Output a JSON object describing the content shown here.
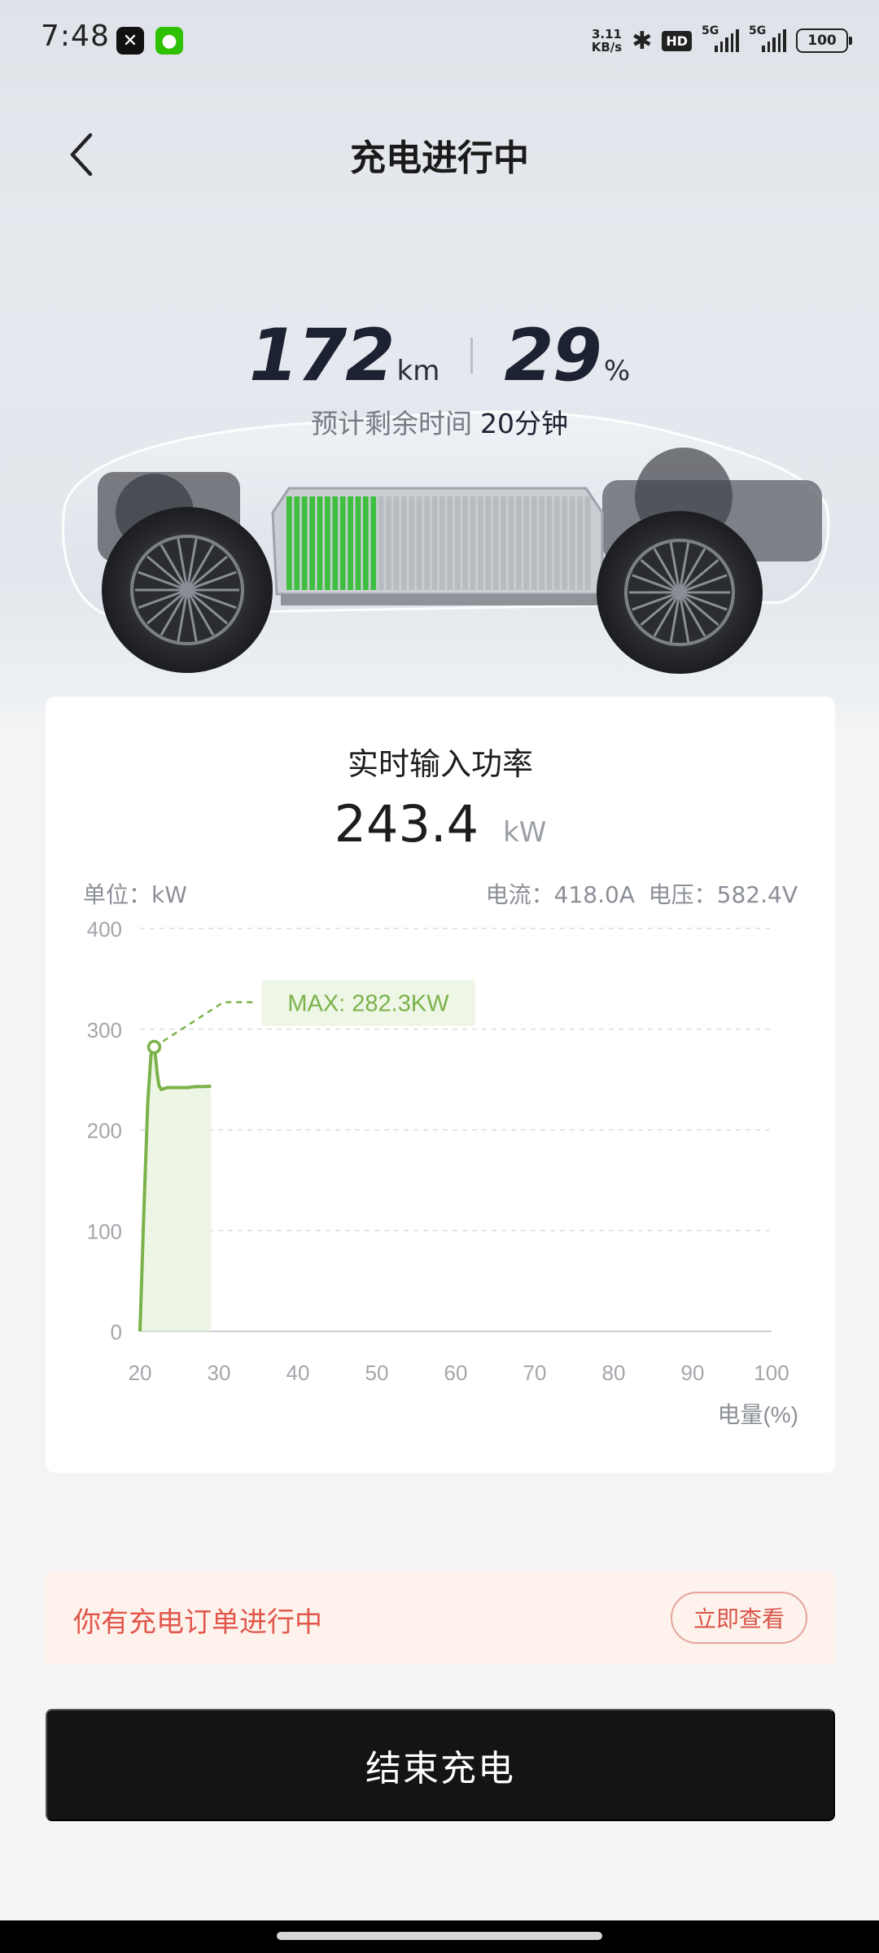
{
  "status_bar": {
    "time": "7:48",
    "net_speed_value": "3.11",
    "net_speed_unit": "KB/s",
    "hd_label": "HD",
    "signal_1_label": "5G",
    "signal_2_label": "5G",
    "battery": "100"
  },
  "header": {
    "title": "充电进行中"
  },
  "hero": {
    "range_value": "172",
    "range_unit": "km",
    "soc_value": "29",
    "soc_unit": "%",
    "eta_label": "预计剩余时间",
    "eta_value": "20分钟",
    "battery_fill_fraction": 0.29
  },
  "power_card": {
    "title": "实时输入功率",
    "power_value": "243.4",
    "power_unit": "kW",
    "unit_label": "单位：kW",
    "current_label": "电流：418.0A",
    "voltage_label": "电压：582.4V",
    "max_label": "MAX: 282.3KW",
    "x_axis_label": "电量(%)"
  },
  "chart_data": {
    "type": "line",
    "xlim": [
      20,
      100
    ],
    "ylim": [
      0,
      400
    ],
    "x_ticks": [
      "20",
      "30",
      "40",
      "50",
      "60",
      "70",
      "80",
      "90",
      "100"
    ],
    "y_ticks": [
      "400",
      "300",
      "200",
      "100",
      "0"
    ],
    "x_tick_values": [
      20,
      30,
      40,
      50,
      60,
      70,
      80,
      90,
      100
    ],
    "y_tick_values": [
      400,
      300,
      200,
      100,
      0
    ],
    "grid": true,
    "series": [
      {
        "x": [
          20,
          20.5,
          21,
          21.4,
          21.8,
          22,
          22.2,
          22.4,
          22.7,
          23,
          23.5,
          24,
          25,
          26,
          27,
          28,
          29
        ],
        "y": [
          0,
          120,
          230,
          275,
          282.3,
          270,
          255,
          244,
          240,
          241,
          242,
          242,
          242,
          242,
          243,
          243,
          243.4
        ]
      }
    ],
    "max_point": {
      "x": 21.8,
      "y": 282.3
    },
    "colors": {
      "line": "#7bb24a",
      "fill": "#e9f4df",
      "max_label_bg": "#eef6e6",
      "max_label_text": "#7bb24a",
      "grid": "#dcdcdc"
    }
  },
  "order_banner": {
    "text": "你有充电订单进行中",
    "button_label": "立即查看"
  },
  "actions": {
    "end_label": "结束充电"
  }
}
